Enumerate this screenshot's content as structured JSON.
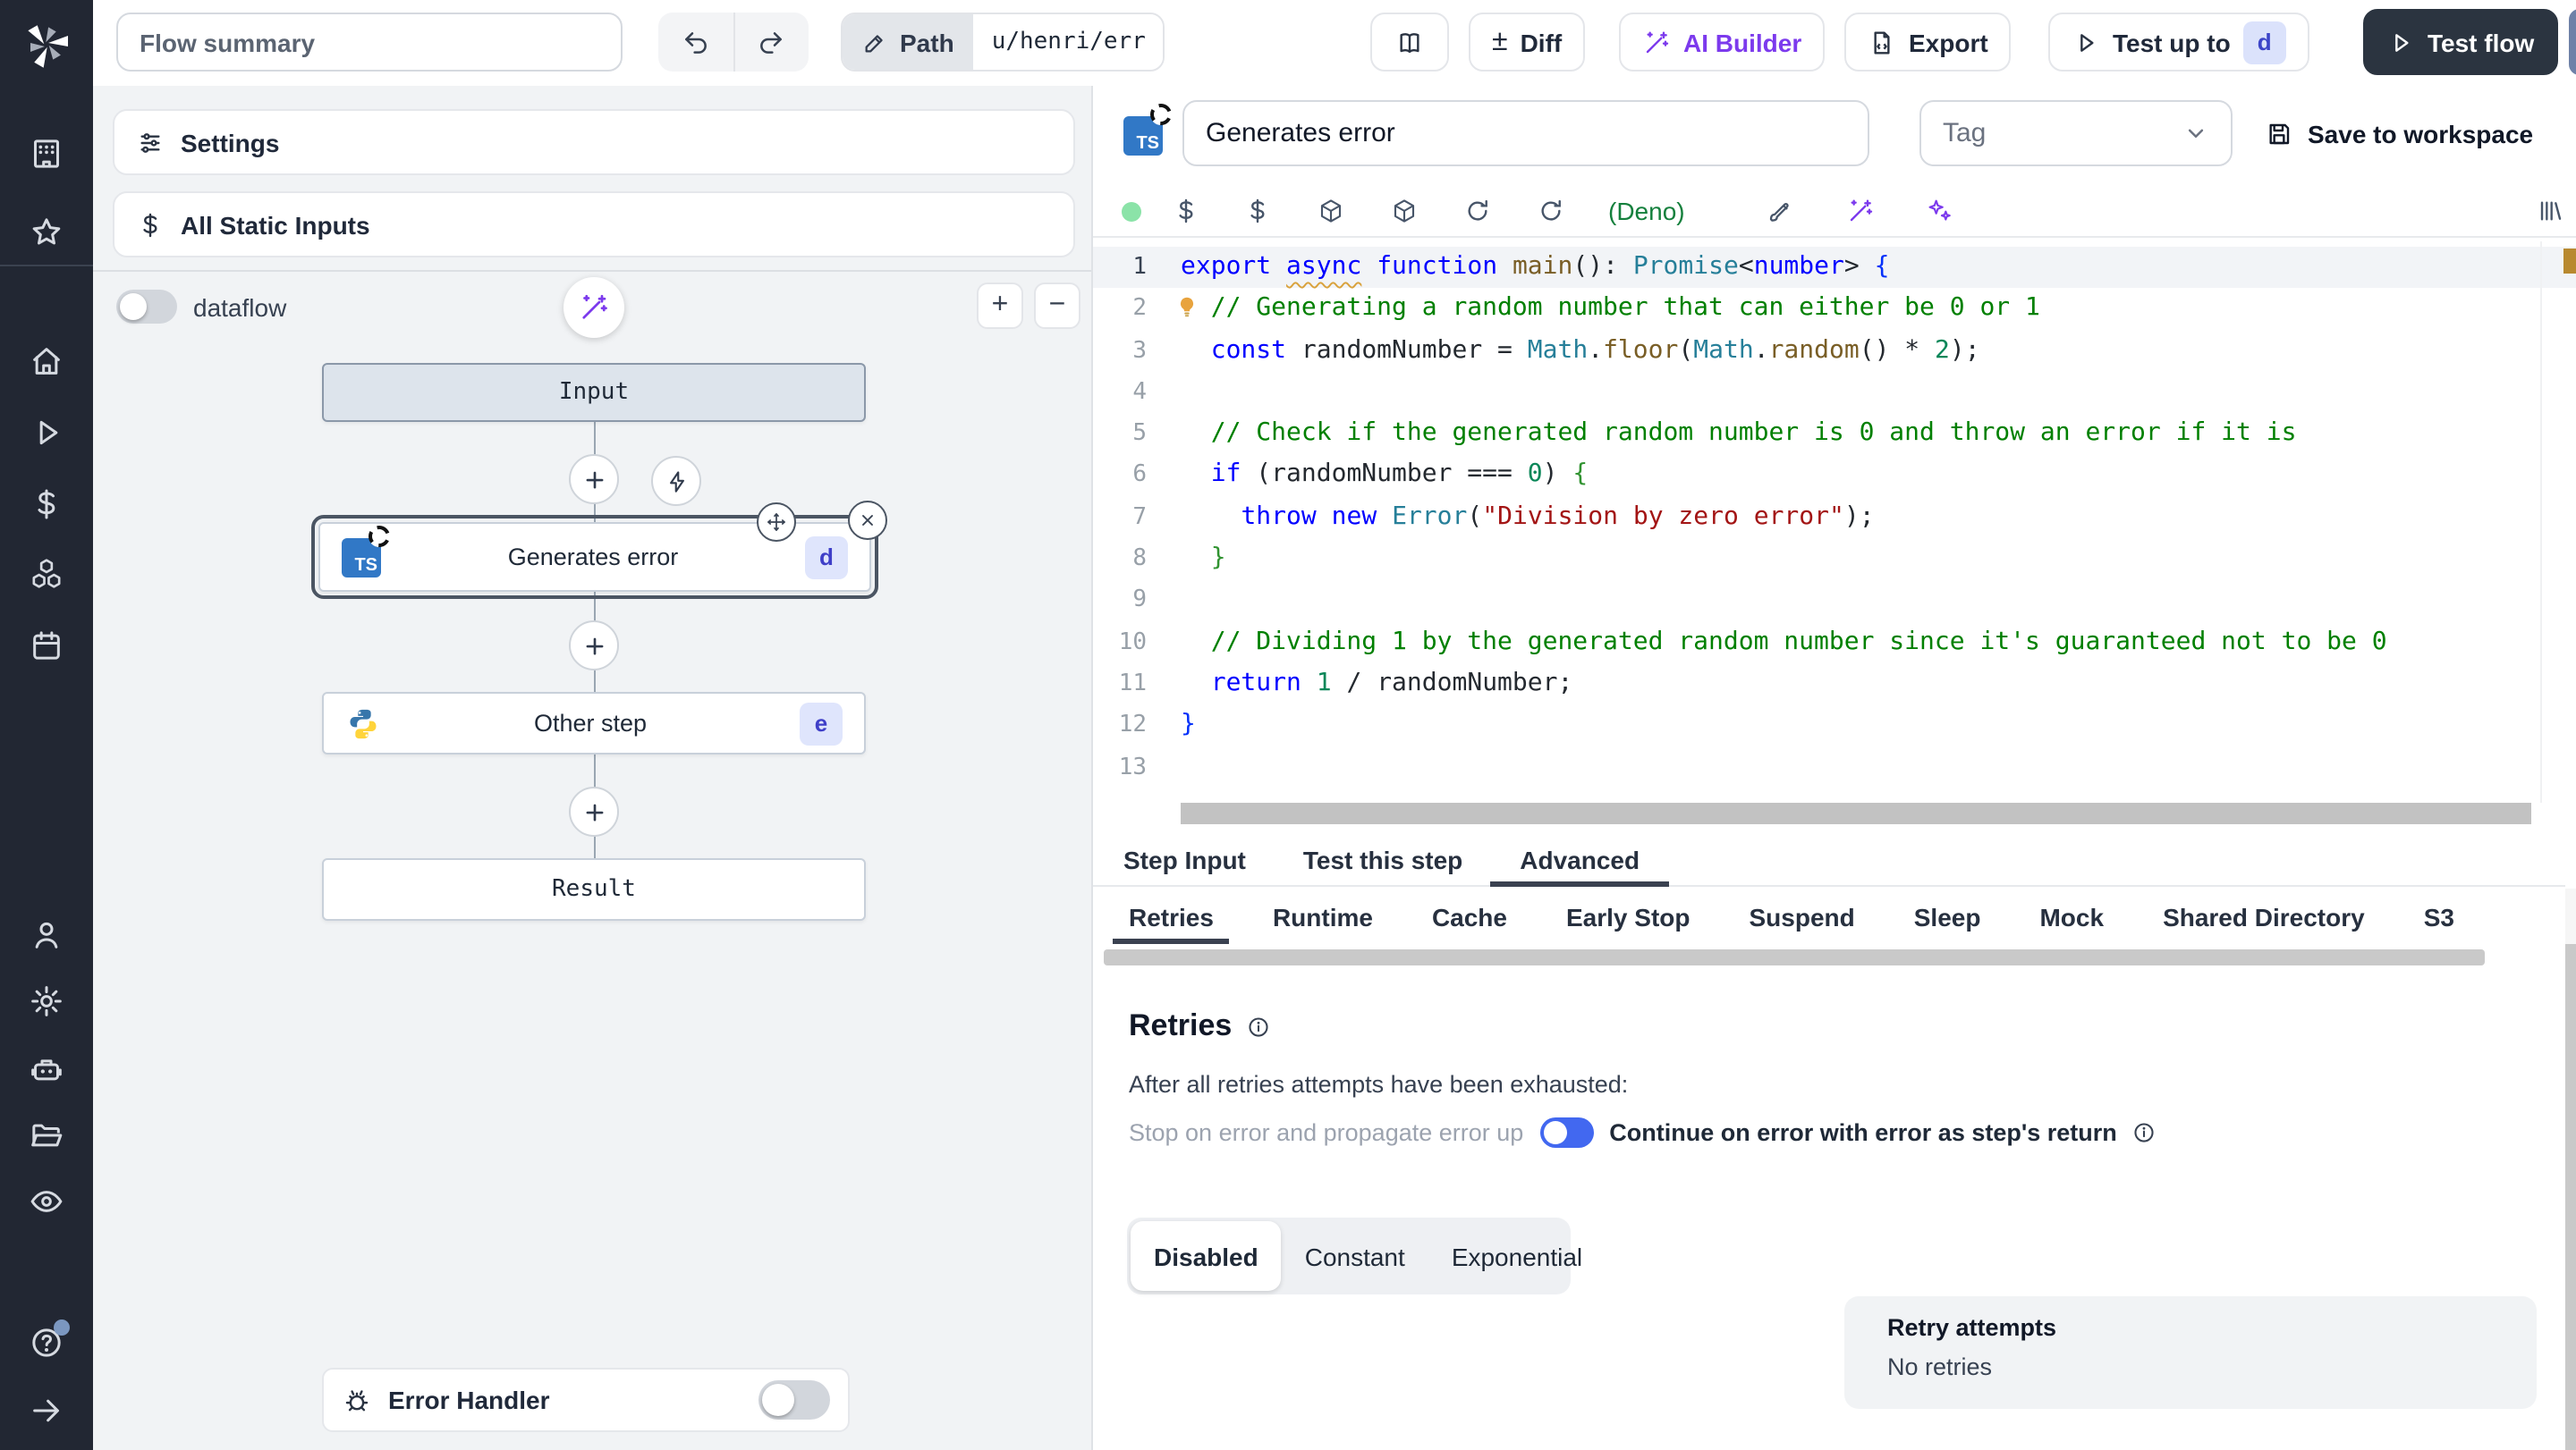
{
  "topbar": {
    "flow_summary_placeholder": "Flow summary",
    "path_label": "Path",
    "path_value": "u/henri/err",
    "diff_label": "Diff",
    "diff_icon_glyph": "±",
    "ai_builder_label": "AI Builder",
    "export_label": "Export",
    "test_up_to_label": "Test up to",
    "test_up_to_badge": "d",
    "test_flow_label": "Test flow"
  },
  "left_panel": {
    "settings_label": "Settings",
    "static_inputs_label": "All Static Inputs",
    "dataflow_label": "dataflow",
    "zoom_in_label": "+",
    "zoom_out_label": "−",
    "graph": {
      "input_label": "Input",
      "result_label": "Result",
      "steps": [
        {
          "name": "Generates error",
          "id": "d",
          "lang": "typescript",
          "selected": true
        },
        {
          "name": "Other step",
          "id": "e",
          "lang": "python",
          "selected": false
        }
      ]
    },
    "error_handler_label": "Error Handler"
  },
  "editor": {
    "step_name": "Generates error",
    "ts_badge": "TS",
    "tag_placeholder": "Tag",
    "save_label": "Save to workspace",
    "deno_label": "(Deno)",
    "code": {
      "language": "typescript",
      "lines": [
        [
          {
            "c": "k",
            "t": "export "
          },
          {
            "c": "kx",
            "t": "async"
          },
          {
            "c": "k",
            "t": " function "
          },
          {
            "c": "f",
            "t": "main"
          },
          {
            "c": "d",
            "t": "(): "
          },
          {
            "c": "t",
            "t": "Promise"
          },
          {
            "c": "d",
            "t": "<"
          },
          {
            "c": "k",
            "t": "number"
          },
          {
            "c": "d",
            "t": "> "
          },
          {
            "c": "b1",
            "t": "{"
          }
        ],
        [
          {
            "c": "d",
            "t": "  "
          },
          {
            "c": "c",
            "t": "// Generating a random number that can either be 0 or 1"
          }
        ],
        [
          {
            "c": "d",
            "t": "  "
          },
          {
            "c": "k",
            "t": "const"
          },
          {
            "c": "d",
            "t": " randomNumber = "
          },
          {
            "c": "t",
            "t": "Math"
          },
          {
            "c": "d",
            "t": "."
          },
          {
            "c": "f",
            "t": "floor"
          },
          {
            "c": "d",
            "t": "("
          },
          {
            "c": "t",
            "t": "Math"
          },
          {
            "c": "d",
            "t": "."
          },
          {
            "c": "f",
            "t": "random"
          },
          {
            "c": "d",
            "t": "() * "
          },
          {
            "c": "n",
            "t": "2"
          },
          {
            "c": "d",
            "t": ");"
          }
        ],
        [],
        [
          {
            "c": "d",
            "t": "  "
          },
          {
            "c": "c",
            "t": "// Check if the generated random number is 0 and throw an error if it is"
          }
        ],
        [
          {
            "c": "d",
            "t": "  "
          },
          {
            "c": "k",
            "t": "if"
          },
          {
            "c": "d",
            "t": " (randomNumber === "
          },
          {
            "c": "n",
            "t": "0"
          },
          {
            "c": "d",
            "t": ") "
          },
          {
            "c": "b2",
            "t": "{"
          }
        ],
        [
          {
            "c": "d",
            "t": "    "
          },
          {
            "c": "k",
            "t": "throw"
          },
          {
            "c": "d",
            "t": " "
          },
          {
            "c": "k",
            "t": "new"
          },
          {
            "c": "d",
            "t": " "
          },
          {
            "c": "t",
            "t": "Error"
          },
          {
            "c": "d",
            "t": "("
          },
          {
            "c": "s",
            "t": "\"Division by zero error\""
          },
          {
            "c": "d",
            "t": ");"
          }
        ],
        [
          {
            "c": "d",
            "t": "  "
          },
          {
            "c": "b2",
            "t": "}"
          }
        ],
        [],
        [
          {
            "c": "d",
            "t": "  "
          },
          {
            "c": "c",
            "t": "// Dividing 1 by the generated random number since it's guaranteed not to be 0"
          }
        ],
        [
          {
            "c": "d",
            "t": "  "
          },
          {
            "c": "k",
            "t": "return"
          },
          {
            "c": "d",
            "t": " "
          },
          {
            "c": "n",
            "t": "1"
          },
          {
            "c": "d",
            "t": " / randomNumber;"
          }
        ],
        [
          {
            "c": "b1",
            "t": "}"
          }
        ],
        []
      ]
    }
  },
  "tabs": {
    "items": [
      "Step Input",
      "Test this step",
      "Advanced"
    ],
    "active": "Advanced"
  },
  "subtabs": {
    "items": [
      "Retries",
      "Runtime",
      "Cache",
      "Early Stop",
      "Suspend",
      "Sleep",
      "Mock",
      "Shared Directory",
      "S3"
    ],
    "active": "Retries"
  },
  "retries": {
    "title": "Retries",
    "exhausted_text": "After all retries attempts have been exhausted:",
    "stop_label": "Stop on error and propagate error up",
    "continue_label": "Continue on error with error as step's return",
    "continue_enabled": true,
    "modes": [
      "Disabled",
      "Constant",
      "Exponential"
    ],
    "active_mode": "Disabled",
    "attempts_title": "Retry attempts",
    "attempts_value": "No retries"
  },
  "colors": {
    "sidebar_bg": "#222733",
    "primary_toggle_blue": "#4268f0",
    "ai_purple": "#7c3aed",
    "deno_green": "#15803d",
    "status_dot_green": "#8be3a8",
    "ts_badge_blue": "#3178c6",
    "step_badge_bg": "#dfe5fc",
    "step_badge_text": "#3f3fc8",
    "warning_marker_gold": "#b8892f",
    "test_flow_bg": "#2b3440"
  }
}
